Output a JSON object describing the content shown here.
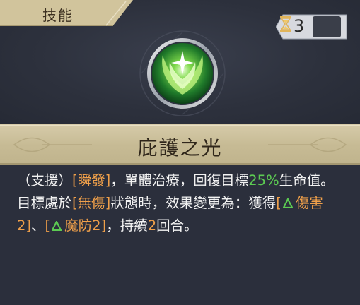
{
  "tab": {
    "label": "技能"
  },
  "cooldown": {
    "value": "3",
    "icon": "hourglass-icon"
  },
  "skill": {
    "icon": "radiant-wings-icon",
    "name": "庇護之光"
  },
  "description": {
    "tag_support": "（支援）",
    "kw_instant": "[瞬發]",
    "text1": "，單體治療，回復目標",
    "pct": "25%",
    "text2": "生命值。目標處於",
    "kw_nodamage": "[無傷]",
    "text3": "狀態時，效果變更為：獲得",
    "bracket_open1": "[",
    "buff1": "傷害2",
    "bracket_close1": "]",
    "sep": "、",
    "bracket_open2": "[",
    "buff2": "魔防2",
    "bracket_close2": "]",
    "text4": "，持續",
    "turns": "2",
    "text5": "回合。"
  },
  "colors": {
    "keyword": "#f0a04a",
    "percent": "#5ccb52",
    "buff_triangle": "#5ccb52",
    "panel": "#2b2f3c",
    "band": "#cfc39f"
  }
}
